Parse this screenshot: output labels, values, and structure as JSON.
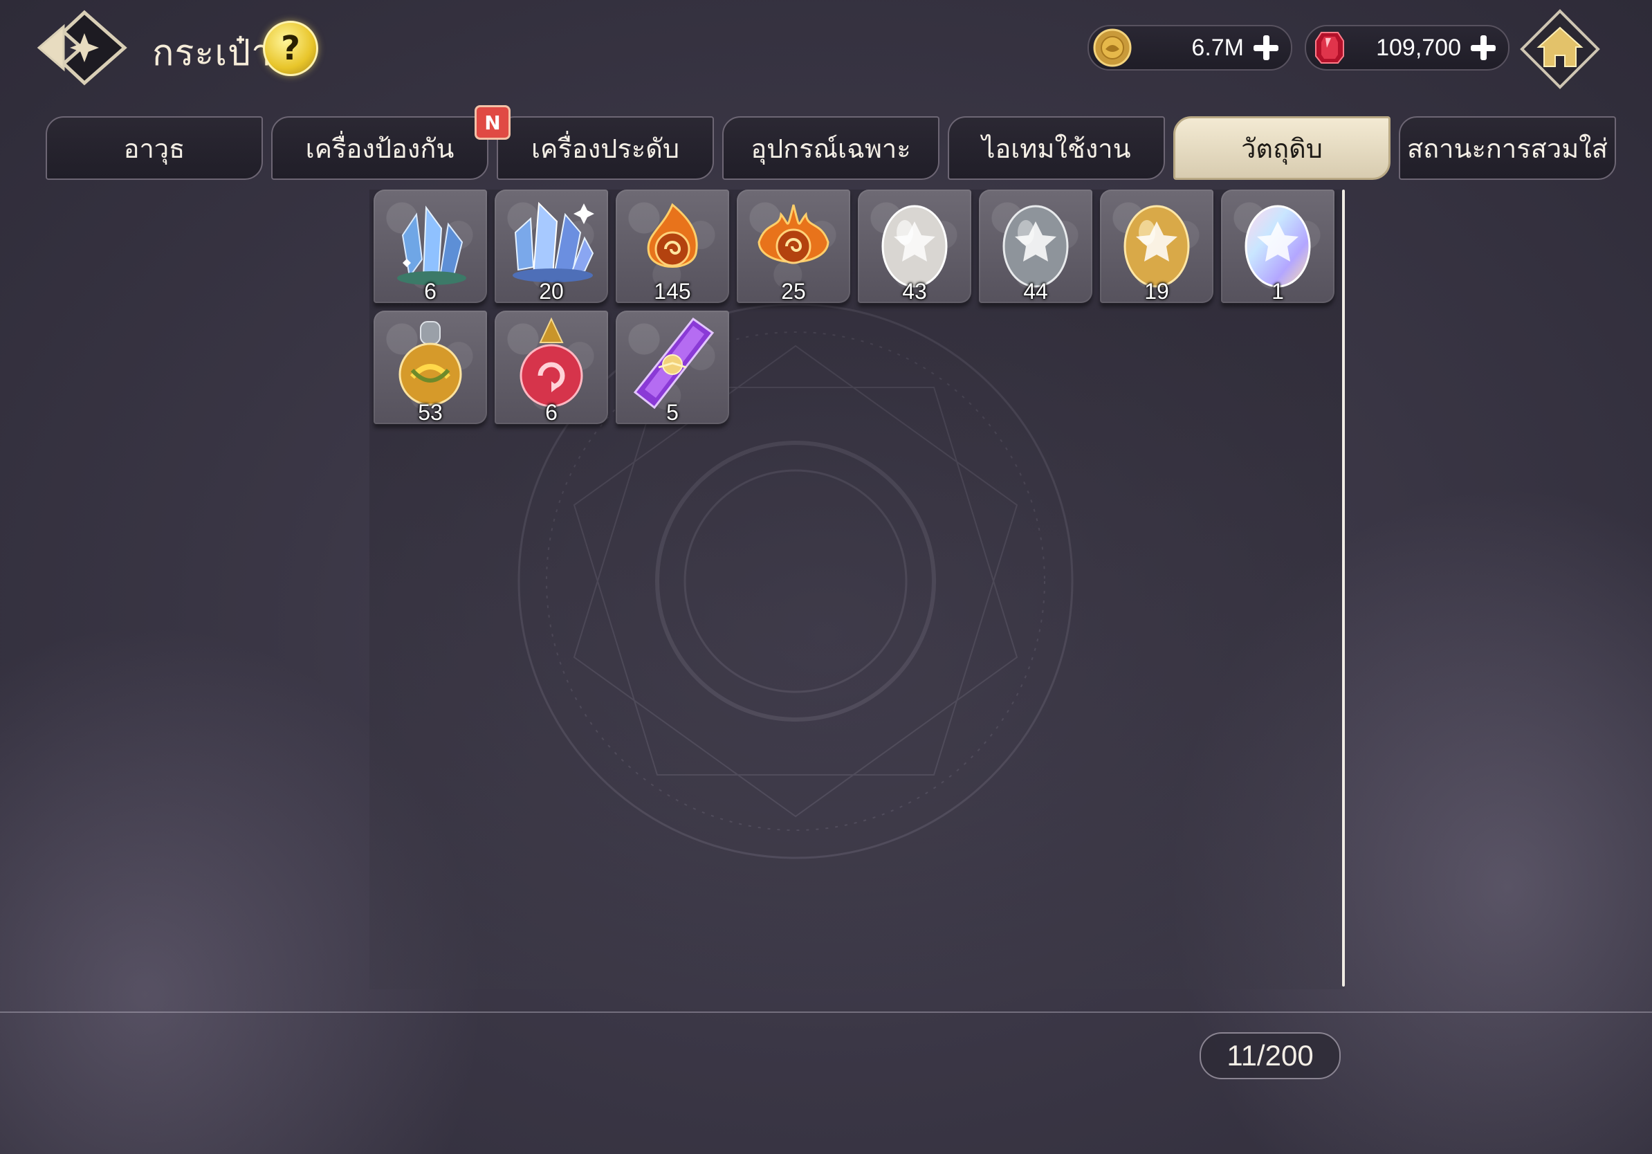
{
  "header": {
    "title": "กระเป๋า",
    "help_label": "?"
  },
  "currencies": {
    "gold": {
      "value": "6.7M",
      "icon": "gold-coin-icon",
      "color": "#e6b84a"
    },
    "gem": {
      "value": "109,700",
      "icon": "red-gem-icon",
      "color": "#d8273a"
    }
  },
  "tabs": [
    {
      "label": "อาวุธ",
      "active": false
    },
    {
      "label": "เครื่องป้องกัน",
      "active": false,
      "badge": "N"
    },
    {
      "label": "เครื่องประดับ",
      "active": false
    },
    {
      "label": "อุปกรณ์เฉพาะ",
      "active": false
    },
    {
      "label": "ไอเทมใช้งาน",
      "active": false
    },
    {
      "label": "วัตถุดิบ",
      "active": true
    },
    {
      "label": "สถานะการสวมใส่",
      "active": false
    }
  ],
  "items": [
    {
      "icon": "blue-crystal-small-icon",
      "qty": "6"
    },
    {
      "icon": "blue-crystal-large-icon",
      "qty": "20"
    },
    {
      "icon": "fire-orb-small-icon",
      "qty": "145"
    },
    {
      "icon": "fire-orb-large-icon",
      "qty": "25"
    },
    {
      "icon": "silver-egg-icon",
      "qty": "43"
    },
    {
      "icon": "dark-silver-egg-icon",
      "qty": "44"
    },
    {
      "icon": "gold-egg-icon",
      "qty": "19"
    },
    {
      "icon": "rainbow-egg-icon",
      "qty": "1"
    },
    {
      "icon": "yellow-potion-icon",
      "qty": "53"
    },
    {
      "icon": "red-potion-icon",
      "qty": "6"
    },
    {
      "icon": "purple-crystal-icon",
      "qty": "5"
    }
  ],
  "capacity": "11/200",
  "colors": {
    "accent": "#f3ead3",
    "badge": "#e04a44",
    "background": "#3b3746"
  }
}
